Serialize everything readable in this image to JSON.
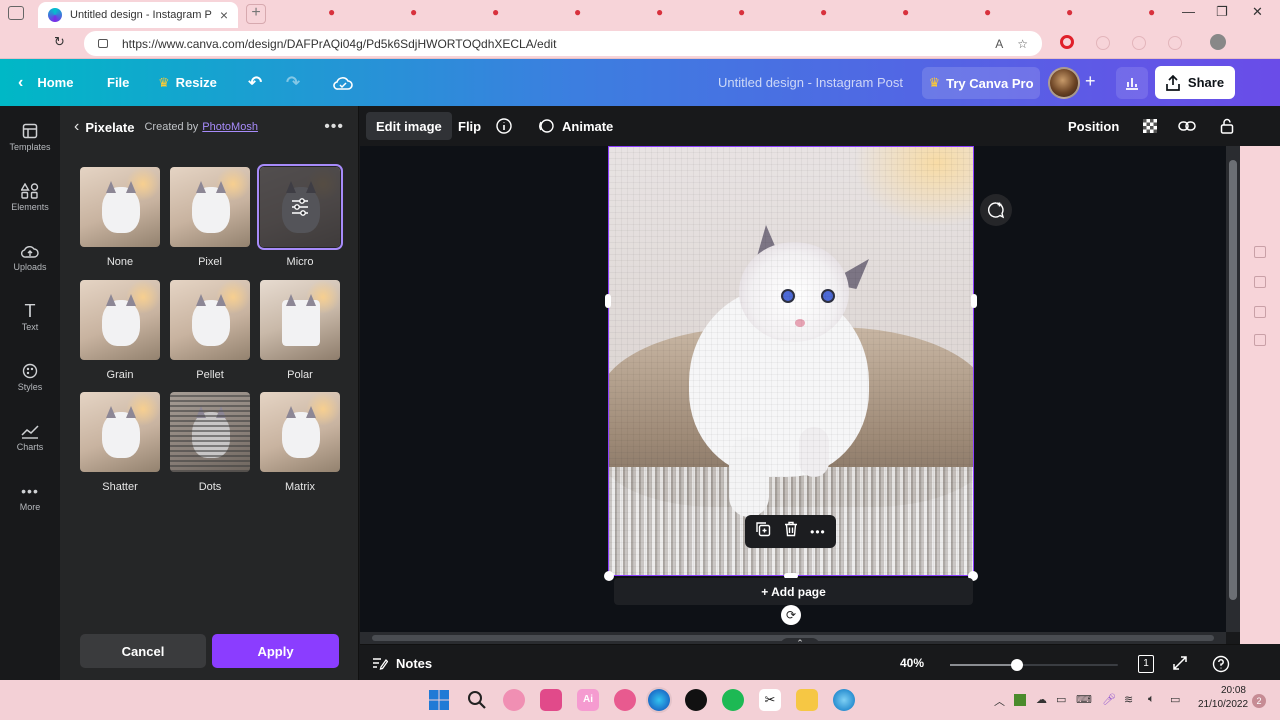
{
  "browser": {
    "tab_title": "Untitled design - Instagram Post",
    "url": "https://www.canva.com/design/DAFPrAQi04g/Pd5k6SdjHWORTOQdhXECLA/edit",
    "new_tab": "+",
    "tab_close": "×"
  },
  "header": {
    "home": "Home",
    "file": "File",
    "resize": "Resize",
    "doc_title": "Untitled design - Instagram Post",
    "try_pro": "Try Canva Pro",
    "share": "Share",
    "plus": "+"
  },
  "rail": [
    {
      "label": "Templates",
      "icon": "templates-icon"
    },
    {
      "label": "Elements",
      "icon": "elements-icon"
    },
    {
      "label": "Uploads",
      "icon": "uploads-icon"
    },
    {
      "label": "Text",
      "icon": "text-icon"
    },
    {
      "label": "Styles",
      "icon": "styles-icon"
    },
    {
      "label": "Charts",
      "icon": "charts-icon"
    },
    {
      "label": "More",
      "icon": "more-icon"
    }
  ],
  "panel": {
    "title": "Pixelate",
    "created_by": "Created by",
    "creator": "PhotoMosh",
    "effects": [
      {
        "label": "None"
      },
      {
        "label": "Pixel"
      },
      {
        "label": "Micro",
        "selected": true
      },
      {
        "label": "Grain"
      },
      {
        "label": "Pellet"
      },
      {
        "label": "Polar"
      },
      {
        "label": "Shatter"
      },
      {
        "label": "Dots"
      },
      {
        "label": "Matrix"
      }
    ],
    "cancel": "Cancel",
    "apply": "Apply"
  },
  "toolbar": {
    "edit_image": "Edit image",
    "flip": "Flip",
    "animate": "Animate",
    "position": "Position"
  },
  "canvas": {
    "add_page": "+ Add page"
  },
  "footer": {
    "notes": "Notes",
    "zoom": "40%",
    "zoom_fraction": 0.4,
    "page_count": "1"
  },
  "taskbar": {
    "time": "20:08",
    "date": "21/10/2022",
    "notification_count": "2"
  },
  "colors": {
    "accent": "#8b3dff",
    "header_gradient_start": "#00b8c6",
    "header_gradient_end": "#6a4ce8",
    "panel_bg": "#252627"
  }
}
